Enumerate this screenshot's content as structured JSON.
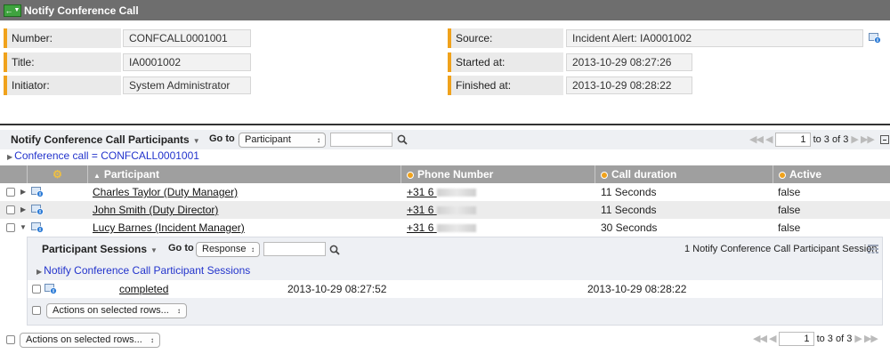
{
  "header": {
    "title": "Notify Conference Call"
  },
  "form": {
    "number_label": "Number:",
    "number_value": "CONFCALL0001001",
    "title_label": "Title:",
    "title_value": "IA0001002",
    "initiator_label": "Initiator:",
    "initiator_value": "System Administrator",
    "source_label": "Source:",
    "source_value": "Incident Alert: IA0001002",
    "started_label": "Started at:",
    "started_value": "2013-10-29 08:27:26",
    "finished_label": "Finished at:",
    "finished_value": "2013-10-29 08:28:22"
  },
  "list": {
    "title": "Notify Conference Call Participants",
    "goto_label": "Go to",
    "goto_select": "Participant",
    "page_value": "1",
    "page_info": "to 3 of 3",
    "breadcrumb": "Conference call = CONFCALL0001001",
    "columns": {
      "participant": "Participant",
      "phone": "Phone Number",
      "duration": "Call duration",
      "active": "Active"
    },
    "rows": [
      {
        "participant": "Charles Taylor (Duty Manager)",
        "phone_prefix": "+31 6",
        "duration": "11 Seconds",
        "active": "false"
      },
      {
        "participant": "John Smith (Duty Director)",
        "phone_prefix": "+31 6",
        "duration": "11 Seconds",
        "active": "false"
      },
      {
        "participant": "Lucy Barnes (Incident Manager)",
        "phone_prefix": "+31 6",
        "duration": "30 Seconds",
        "active": "false"
      }
    ]
  },
  "nested": {
    "title": "Participant Sessions",
    "goto_label": "Go to",
    "goto_select": "Response",
    "count_info": "1 Notify Conference Call Participant Session",
    "breadcrumb": "Notify Conference Call Participant Sessions",
    "row": {
      "status": "completed",
      "start": "2013-10-29 08:27:52",
      "end": "2013-10-29 08:28:22"
    },
    "actions": "Actions on selected rows..."
  },
  "footer": {
    "actions": "Actions on selected rows...",
    "page_value": "1",
    "page_info": "to 3 of 3"
  },
  "colors": {
    "accent": "#f0a21c",
    "link": "#2233cc",
    "header_bg": "#6e6e6e",
    "table_header": "#9f9f9f"
  }
}
